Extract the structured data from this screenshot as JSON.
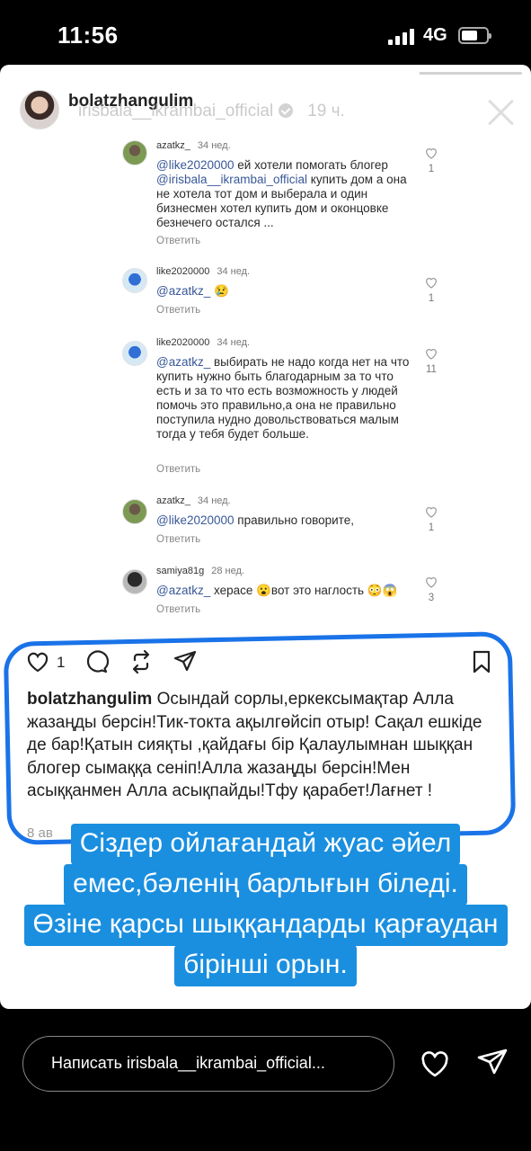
{
  "status": {
    "time": "11:56",
    "network": "4G",
    "battery_level": 0.65
  },
  "story": {
    "progress": 0.8,
    "username": "bolatzhangulim",
    "sub_account": "irisbala__ikrambai_official",
    "time_ago": "19 ч."
  },
  "comments": [
    {
      "user": "azatkz_",
      "time": "34 нед.",
      "mention": "@like2020000",
      "text": " ей хотели помогать блогер ",
      "mention2": "@irisbala__ikrambai_official",
      "text2": " купить дом а она не хотела тот дом и выберала и один бизнесмен хотел купить дом и оконцовке безнечего остался ...",
      "reply": "Ответить",
      "likes": "1"
    },
    {
      "user": "like2020000",
      "time": "34 нед.",
      "mention": "@azatkz_",
      "text": " 😢",
      "reply": "Ответить",
      "likes": "1"
    },
    {
      "user": "like2020000",
      "time": "34 нед.",
      "mention": "@azatkz_",
      "text": " выбирать не надо когда нет на что купить нужно быть благодарным за то что есть и за то что есть возможность у людей помочь это правильно,а она не правильно поступила нудно довольствоваться малым тогда у тебя будет больше.",
      "reply": "Ответить",
      "likes": "11"
    },
    {
      "user": "azatkz_",
      "time": "34 нед.",
      "mention": "@like2020000",
      "text": " правильно говорите,",
      "reply": "Ответить",
      "likes": "1"
    },
    {
      "user": "samiya81g",
      "time": "28 нед.",
      "mention": "@azatkz_",
      "text": " херасе 😮вот это наглость 😳😱",
      "reply": "Ответить",
      "likes": "3"
    }
  ],
  "post": {
    "like_count": "1",
    "caption_user": "bolatzhangulim",
    "caption_text": " Осындай сорлы,еркексымақтар Алла жазаңды берсін!Тик-токта ақылгөйсіп отыр! Сақал ешкіде де бар!Қатын сияқты ,қайдағы бір Қалаулымнан шыққан  блогер сымаққа сеніп!Алла жазаңды берсін!Мен асыққанмен Алла асықпайды!Тфу қарабет!Лағнет !",
    "date": "8 ав"
  },
  "overlay": {
    "line1": "Сіздер ойлағандай жуас әйел",
    "line2": "емес,бәленің барлығын біледі.",
    "line3": "Өзіне қарсы шыққандарды қарғаудан",
    "line4": "бірінші орын."
  },
  "reply_bar": {
    "placeholder": "Написать irisbala__ikrambai_official..."
  },
  "colors": {
    "accent_blue": "#1a8fe0",
    "outline_blue": "#1a73e8",
    "mention": "#385898"
  },
  "icons": [
    "close-icon",
    "verified-icon",
    "heart-icon",
    "comment-icon",
    "repost-icon",
    "share-icon",
    "bookmark-icon",
    "send-icon"
  ]
}
